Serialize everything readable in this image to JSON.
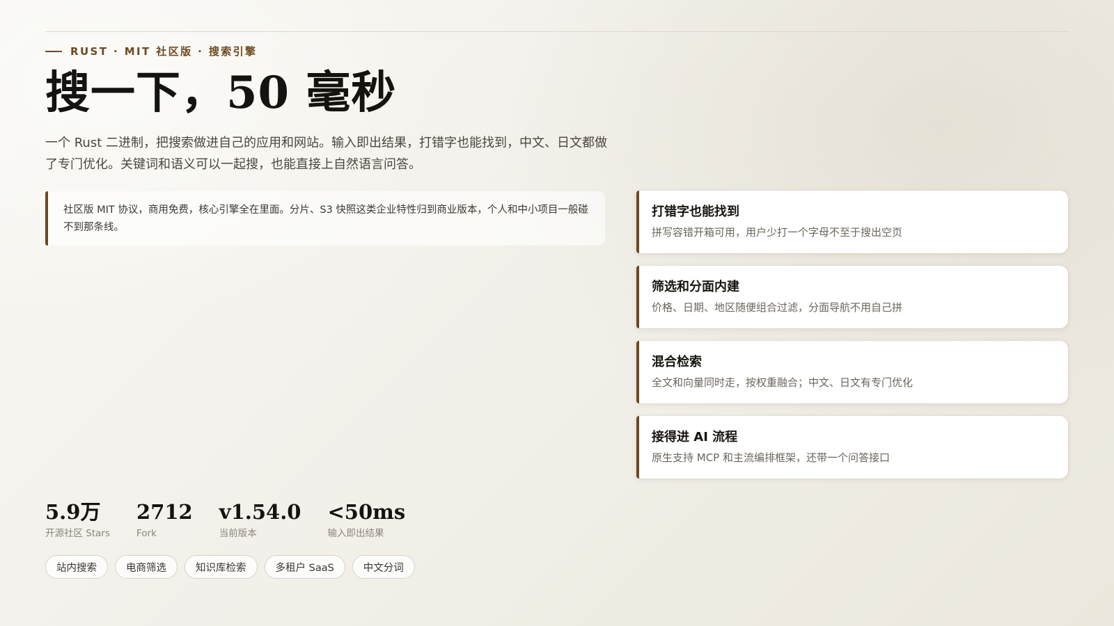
{
  "hero": {
    "eyebrow": "RUST · MIT 社区版 · 搜索引擎",
    "title": "搜一下，50 毫秒",
    "lede": "一个 Rust 二进制，把搜索做进自己的应用和网站。输入即出结果，打错字也能找到，中文、日文都做了专门优化。关键词和语义可以一起搜，也能直接上自然语言问答。",
    "callout": "社区版 MIT 协议，商用免费，核心引擎全在里面。分片、S3 快照这类企业特性归到商业版本，个人和中小项目一般碰不到那条线。"
  },
  "features": [
    {
      "title": "打错字也能找到",
      "desc": "拼写容错开箱可用，用户少打一个字母不至于搜出空页"
    },
    {
      "title": "筛选和分面内建",
      "desc": "价格、日期、地区随便组合过滤，分面导航不用自己拼"
    },
    {
      "title": "混合检索",
      "desc": "全文和向量同时走，按权重融合；中文、日文有专门优化"
    },
    {
      "title": "接得进 AI 流程",
      "desc": "原生支持 MCP 和主流编排框架，还带一个问答接口"
    }
  ],
  "stats": [
    {
      "value": "5.9万",
      "label": "开源社区 Stars"
    },
    {
      "value": "2712",
      "label": "Fork"
    },
    {
      "value": "v1.54.0",
      "label": "当前版本"
    },
    {
      "value": "<50ms",
      "label": "输入即出结果"
    }
  ],
  "tags": [
    "站内搜索",
    "电商筛选",
    "知识库检索",
    "多租户 SaaS",
    "中文分词"
  ],
  "colors": {
    "accent": "#6b4a22",
    "background": "#f4f2ec",
    "card": "#ffffff",
    "text": "#15130f",
    "muted": "#6a655c"
  }
}
